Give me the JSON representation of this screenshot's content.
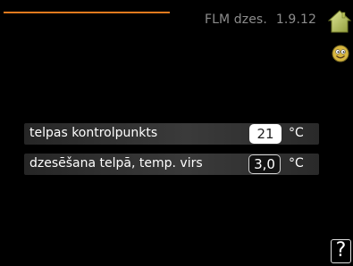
{
  "header": {
    "menu_name": "FLM dzes.",
    "menu_number": "1.9.12",
    "accent_color": "#e07a1e"
  },
  "icons": {
    "mode": "house-icon",
    "status": "smiley-icon",
    "help": "help-icon"
  },
  "settings": [
    {
      "label": "telpas kontrolpunkts",
      "value": "21",
      "unit": "°C",
      "selected": true
    },
    {
      "label": "dzesēšana telpā, temp. virs",
      "value": "3,0",
      "unit": "°C",
      "selected": false
    }
  ],
  "help": {
    "label": "?"
  }
}
